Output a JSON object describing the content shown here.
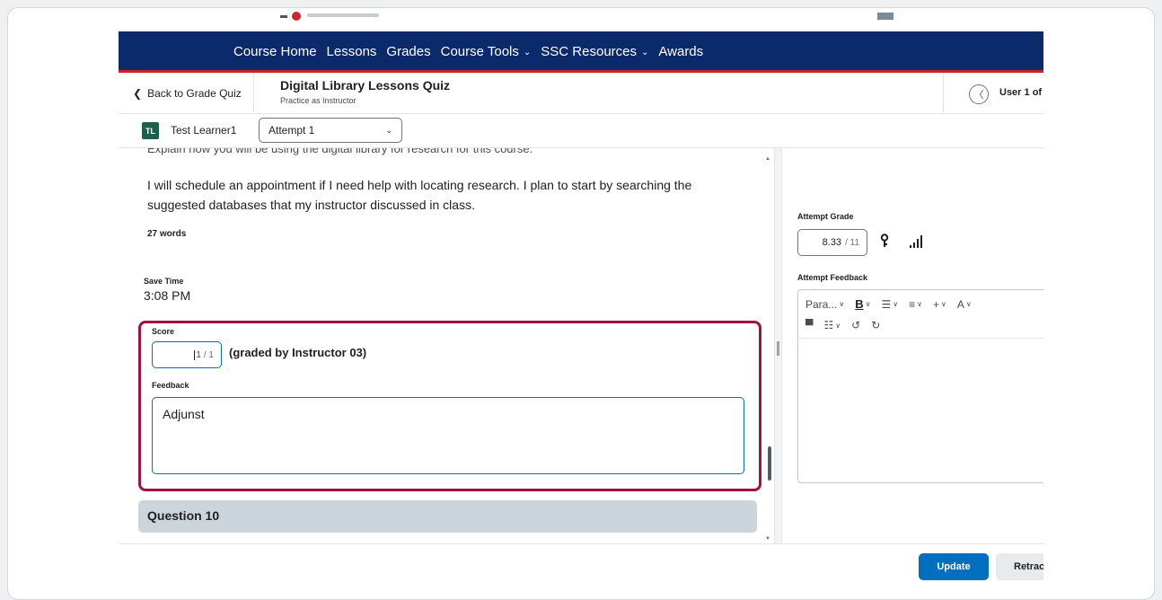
{
  "nav": {
    "items": [
      {
        "label": "Course Home",
        "dropdown": false
      },
      {
        "label": "Lessons",
        "dropdown": false
      },
      {
        "label": "Grades",
        "dropdown": false
      },
      {
        "label": "Course Tools",
        "dropdown": true
      },
      {
        "label": "SSC Resources",
        "dropdown": true
      },
      {
        "label": "Awards",
        "dropdown": false
      }
    ]
  },
  "header": {
    "back_label": "Back to Grade Quiz",
    "quiz_title": "Digital Library Lessons Quiz",
    "quiz_subtitle": "Practice as Instructor",
    "user_of": "User 1 of"
  },
  "learner": {
    "initials": "TL",
    "name": "Test Learner1",
    "attempt_selected": "Attempt 1"
  },
  "question": {
    "prompt_cut": "Explain how you will be using the digital library for research for this course.",
    "answer": "I will schedule an appointment if I need help with locating research. I plan to start by searching the suggested databases that my instructor discussed in class.",
    "word_count": "27 words",
    "save_time_label": "Save Time",
    "save_time": "3:08 PM",
    "score_label": "Score",
    "score_value": "1",
    "score_out_of": "/ 1",
    "graded_by": "(graded by Instructor 03)",
    "feedback_label": "Feedback",
    "feedback_text": "Adjunst",
    "next_question": "Question 10"
  },
  "attempt": {
    "grade_label": "Attempt Grade",
    "grade_value": "8.33",
    "grade_out_of": "/ 11",
    "feedback_label": "Attempt Feedback",
    "toolbar": {
      "paragraph": "Para...",
      "bold": "B"
    }
  },
  "footer": {
    "update_label": "Update",
    "retract_label": "Retract"
  },
  "colors": {
    "nav_bg": "#0b2a6b",
    "nav_accent": "#c9252c",
    "highlight_border": "#a3123f",
    "primary_button": "#006fbf",
    "question_bar": "#cdd5dc"
  }
}
